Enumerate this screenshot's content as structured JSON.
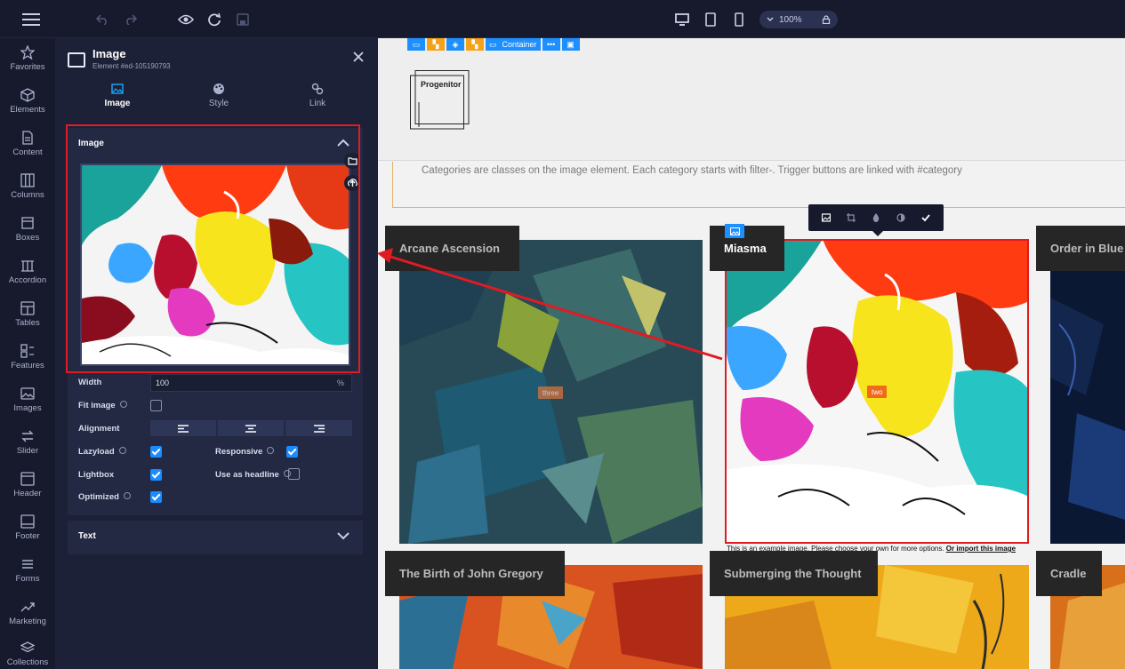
{
  "topbar": {
    "zoom_label": "100%"
  },
  "rail": [
    {
      "label": "Favorites"
    },
    {
      "label": "Elements"
    },
    {
      "label": "Content"
    },
    {
      "label": "Columns"
    },
    {
      "label": "Boxes"
    },
    {
      "label": "Accordion"
    },
    {
      "label": "Tables"
    },
    {
      "label": "Features"
    },
    {
      "label": "Images"
    },
    {
      "label": "Slider"
    },
    {
      "label": "Header"
    },
    {
      "label": "Footer"
    },
    {
      "label": "Forms"
    },
    {
      "label": "Marketing"
    },
    {
      "label": "Collections"
    }
  ],
  "panel": {
    "title": "Image",
    "subtitle": "Element #ed-105190793",
    "tabs": [
      {
        "label": "Image"
      },
      {
        "label": "Style"
      },
      {
        "label": "Link"
      }
    ],
    "image_section_title": "Image",
    "width_label": "Width",
    "width_value": "100",
    "width_unit": "%",
    "fit_label": "Fit image",
    "alignment_label": "Alignment",
    "lazyload_label": "Lazyload",
    "responsive_label": "Responsive",
    "lightbox_label": "Lightbox",
    "headline_label": "Use as headline",
    "optimized_label": "Optimized",
    "text_section_title": "Text"
  },
  "canvas": {
    "breadcrumb_container": "Container",
    "logo_text": "Progenitor",
    "description": "Categories are classes on the image element. Each category starts with filter-. Trigger buttons are linked with #category",
    "tiles": [
      {
        "title": "Arcane Ascension",
        "tag": "three"
      },
      {
        "title": "Miasma",
        "tag": "two"
      },
      {
        "title": "Order in Blue"
      },
      {
        "title": "The Birth of John Gregory"
      },
      {
        "title": "Submerging the Thought"
      },
      {
        "title": "Cradle"
      }
    ],
    "note_text": "This is an example image. Please choose your own for more options. ",
    "note_link": "Or import this image"
  },
  "colors": {
    "accent": "#1e8fff",
    "highlight": "#e11b22",
    "crumb_orange": "#f4a21a"
  }
}
